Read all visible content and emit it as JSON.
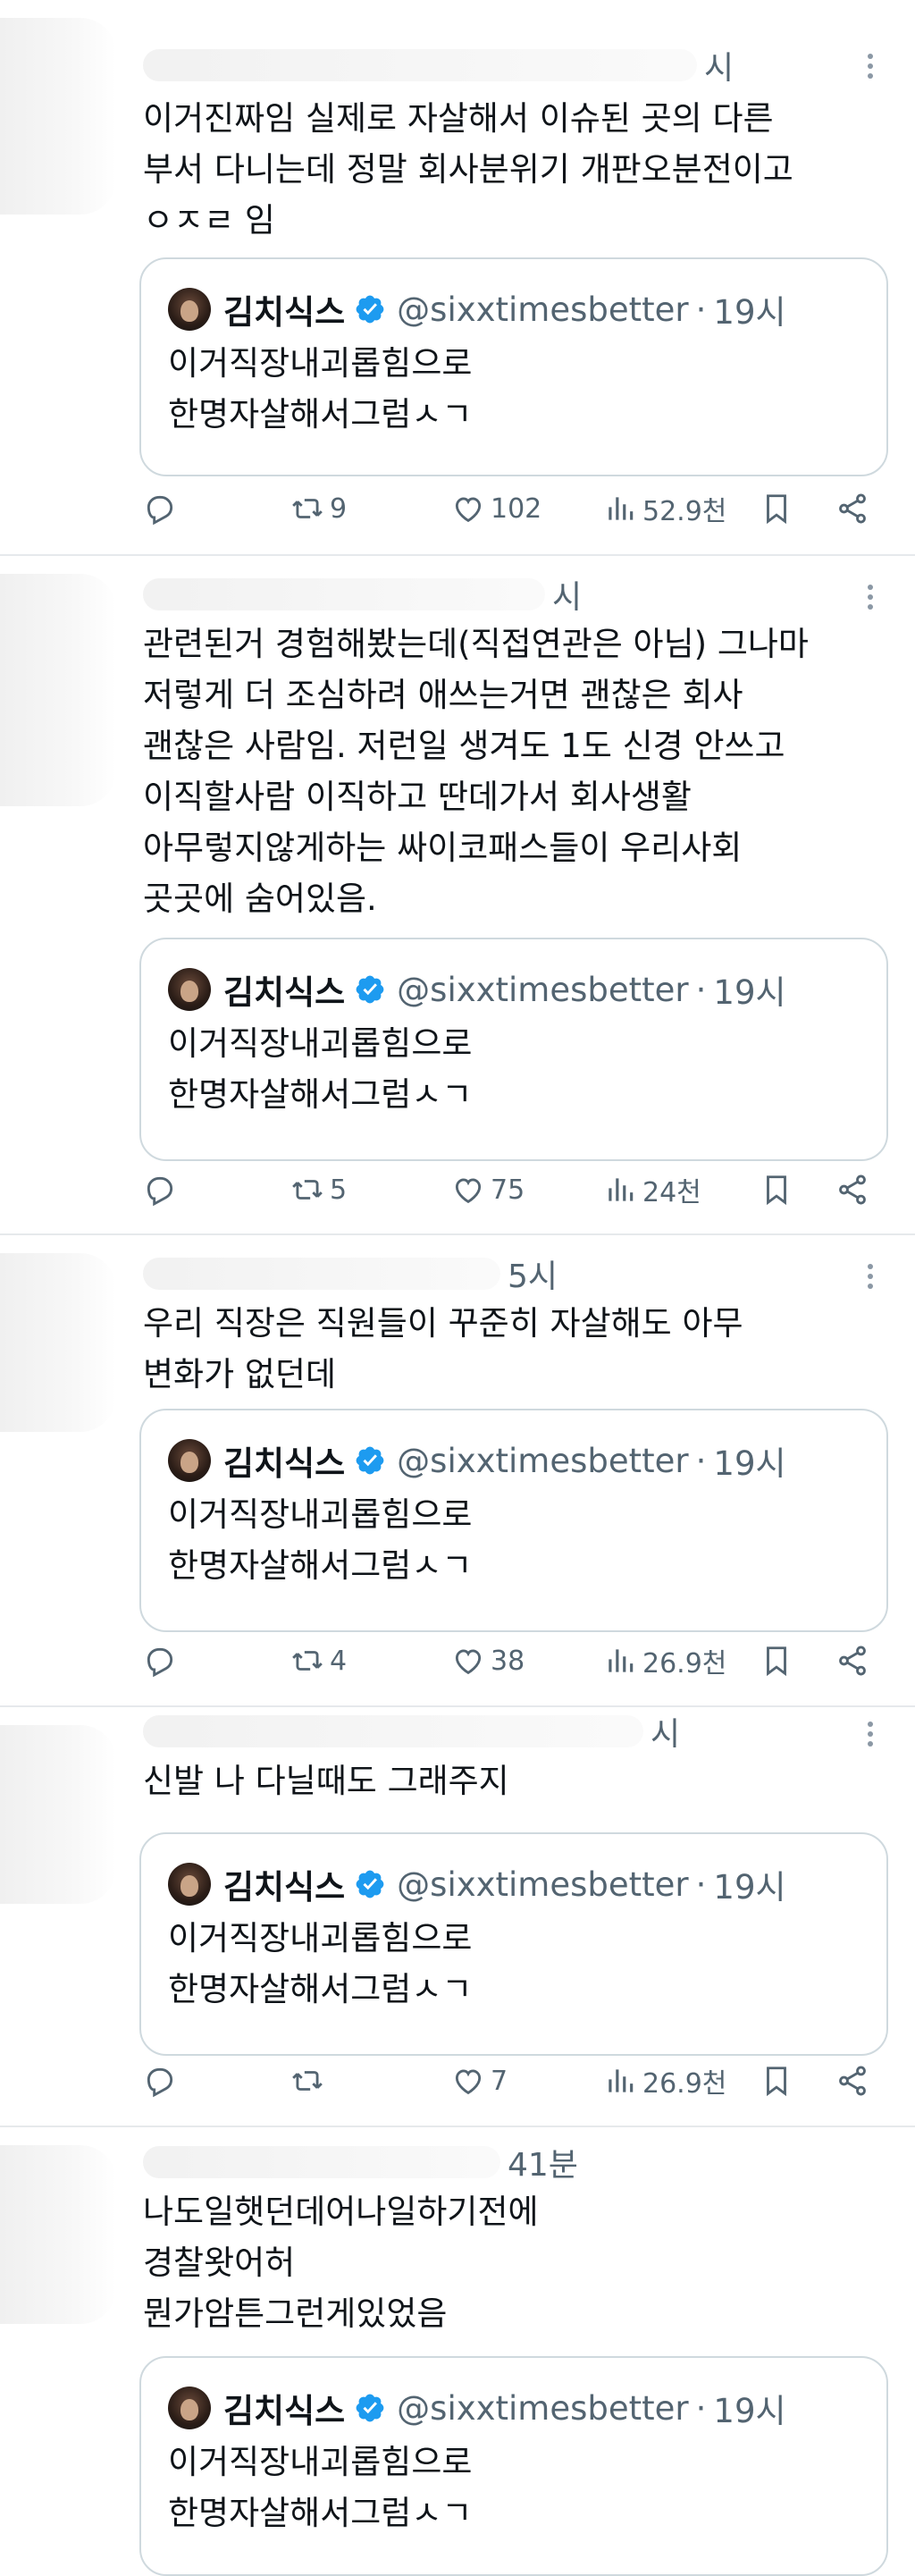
{
  "quoted": {
    "name": "김치식스",
    "handle": "@sixxtimesbetter",
    "separator": "·",
    "time": "19시",
    "text": "이거직장내괴롭힘으로\n한명자살해서그럼ㅅㄱ"
  },
  "tweets": [
    {
      "time_fragment": "시",
      "text": "이거진짜임 실제로 자살해서 이슈된 곳의 다른\n부서 다니는데 정말 회사분위기 개판오분전이고\nㅇㅈㄹ 임",
      "stats": {
        "replies": "",
        "retweets": "9",
        "likes": "102",
        "views": "52.9천"
      }
    },
    {
      "time_fragment": "시",
      "text": "관련된거 경험해봤는데(직접연관은 아님) 그나마\n저렇게 더 조심하려 애쓰는거면 괜찮은 회사\n괜찮은 사람임. 저런일 생겨도 1도 신경 안쓰고\n이직할사람 이직하고 딴데가서 회사생활\n아무렇지않게하는 싸이코패스들이 우리사회\n곳곳에 숨어있음.",
      "stats": {
        "replies": "",
        "retweets": "5",
        "likes": "75",
        "views": "24천"
      }
    },
    {
      "time_fragment": "5시",
      "text": "우리 직장은 직원들이 꾸준히 자살해도 아무\n변화가 없던데",
      "stats": {
        "replies": "",
        "retweets": "4",
        "likes": "38",
        "views": "26.9천"
      }
    },
    {
      "time_fragment": "시",
      "text": "신발 나 다닐때도 그래주지",
      "stats": {
        "replies": "",
        "retweets": "",
        "likes": "7",
        "views": "26.9천"
      }
    },
    {
      "time_fragment": "41분",
      "text": "나도일햇던데어나일하기전에\n경찰왓어허\n뭔가암튼그런게있었음",
      "stats": null
    }
  ],
  "icons": {
    "more": "more-dots-icon",
    "reply": "reply-icon",
    "retweet": "retweet-icon",
    "like": "heart-icon",
    "views": "views-icon",
    "bookmark": "bookmark-icon",
    "share": "share-icon",
    "verified": "verified-badge-icon"
  },
  "colors": {
    "text": "#0f1419",
    "muted": "#536471",
    "border": "#cfd9de",
    "divider": "#e6e9ec",
    "verified": "#1d9bf0"
  }
}
